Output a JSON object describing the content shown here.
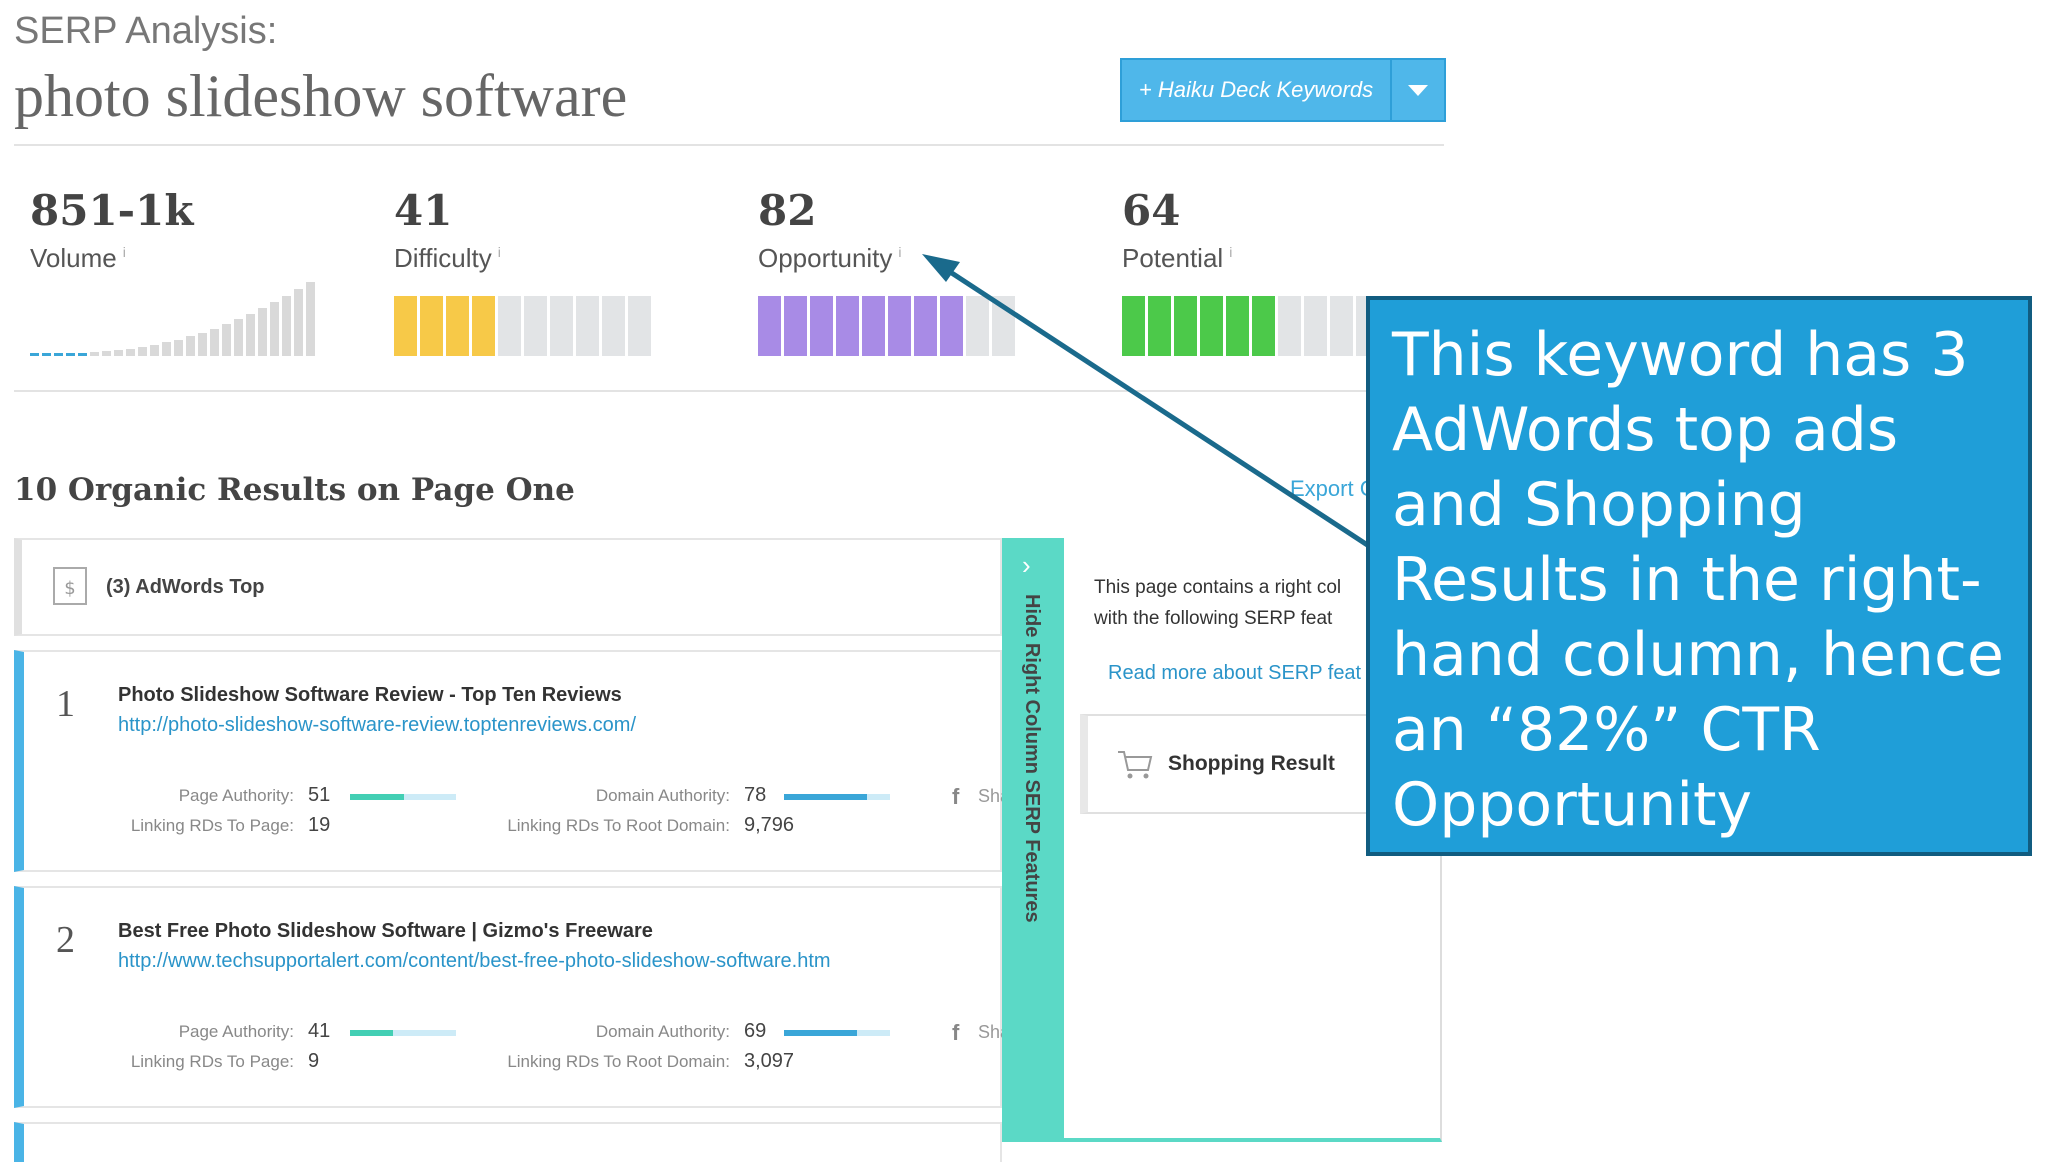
{
  "header": {
    "subtitle": "SERP Analysis:",
    "title": "photo slideshow software",
    "keywords_button": "+ Haiku Deck Keywords"
  },
  "metrics": [
    {
      "value": "851-1k",
      "label": "Volume",
      "info": "i"
    },
    {
      "value": "41",
      "label": "Difficulty",
      "info": "i",
      "filled_segments": 4,
      "total_segments": 10,
      "color": "#f7c948"
    },
    {
      "value": "82",
      "label": "Opportunity",
      "info": "i",
      "filled_segments": 8,
      "total_segments": 10,
      "color": "#a88be6"
    },
    {
      "value": "64",
      "label": "Potential",
      "info": "i",
      "filled_segments": 6,
      "total_segments": 10,
      "color": "#4cc94a"
    }
  ],
  "section": {
    "title": "10 Organic Results on Page One",
    "export_label": "Export C"
  },
  "adwords_row": {
    "label": "(3) AdWords Top"
  },
  "results": [
    {
      "rank": "1",
      "title": "Photo Slideshow Software Review - Top Ten Reviews",
      "url": "http://photo-slideshow-software-review.toptenreviews.com/",
      "page_authority_label": "Page Authority:",
      "page_authority": "51",
      "page_authority_fraction": 0.51,
      "domain_authority_label": "Domain Authority:",
      "domain_authority": "78",
      "domain_authority_fraction": 0.78,
      "linking_rds_page_label": "Linking RDs To Page:",
      "linking_rds_page": "19",
      "linking_rds_root_label": "Linking RDs To Root Domain:",
      "linking_rds_root": "9,796",
      "share_label": "Shar"
    },
    {
      "rank": "2",
      "title": "Best Free Photo Slideshow Software | Gizmo's Freeware",
      "url": "http://www.techsupportalert.com/content/best-free-photo-slideshow-software.htm",
      "page_authority_label": "Page Authority:",
      "page_authority": "41",
      "page_authority_fraction": 0.41,
      "domain_authority_label": "Domain Authority:",
      "domain_authority": "69",
      "domain_authority_fraction": 0.69,
      "linking_rds_page_label": "Linking RDs To Page:",
      "linking_rds_page": "9",
      "linking_rds_root_label": "Linking RDs To Root Domain:",
      "linking_rds_root": "3,097",
      "share_label": "Shar"
    }
  ],
  "right_column": {
    "hide_label": "Hide Right Column SERP Features",
    "text_line1": "This page contains a right col",
    "text_line2": "with the following SERP feat",
    "read_more": "Read more about SERP feat",
    "shopping_label": "Shopping Result"
  },
  "callout": {
    "text": "This keyword has 3 AdWords top ads and Shopping Results in the right-hand column, hence an “82%” CTR Opportunity"
  },
  "colors": {
    "accent_blue": "#4fb7ea",
    "teal": "#5bd9c6",
    "callout_bg": "#1f9ed8",
    "arrow": "#1a6a8c"
  }
}
